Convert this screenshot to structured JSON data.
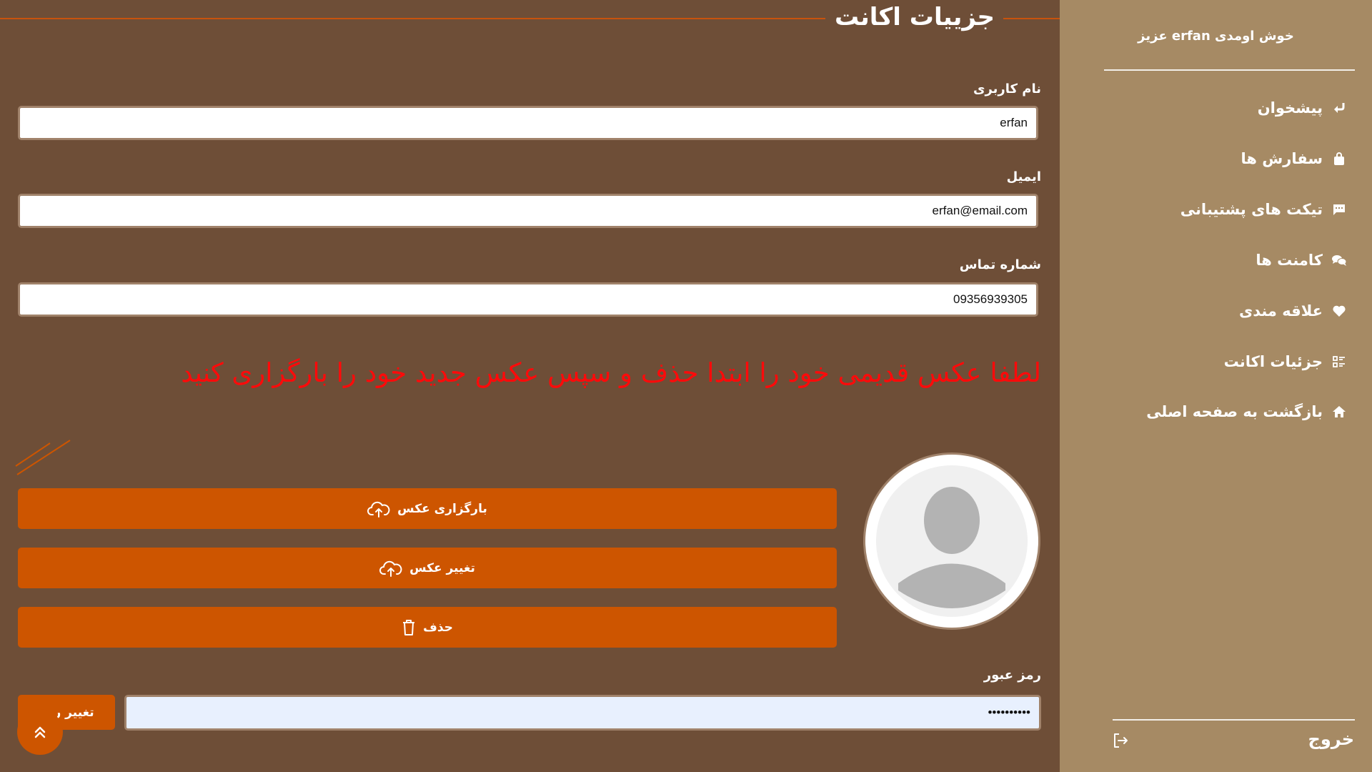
{
  "page": {
    "title": "جزییات اکانت"
  },
  "form": {
    "username": {
      "label": "نام کاربری",
      "value": "erfan"
    },
    "email": {
      "label": "ایمیل",
      "value": "erfan@email.com"
    },
    "phone": {
      "label": "شماره تماس",
      "value": "09356939305"
    },
    "warning": "لطفا عکس قدیمی خود را ابتدا حذف و سپس عکس جدید خود را بارگزاری کنید",
    "upload_button": "بارگزاری عکس",
    "change_button": "تغییر عکس",
    "delete_button": "حذف",
    "password": {
      "label": "رمز عبور",
      "value": "••••••••••"
    },
    "change_password_button": "تغییر رمز"
  },
  "sidebar": {
    "welcome": "خوش اومدی erfan عزیز",
    "items": [
      {
        "label": "پیشخوان",
        "icon": "return-arrow-icon"
      },
      {
        "label": "سفارش ها",
        "icon": "shopping-bag-icon"
      },
      {
        "label": "تیکت های پشتیبانی",
        "icon": "message-icon"
      },
      {
        "label": "کامنت ها",
        "icon": "comments-icon"
      },
      {
        "label": "علاقه مندی",
        "icon": "heart-icon"
      },
      {
        "label": "جزئیات اکانت",
        "icon": "list-details-icon"
      },
      {
        "label": "بازگشت به صفحه اصلی",
        "icon": "home-icon"
      }
    ],
    "logout": "خروج"
  },
  "colors": {
    "main_bg": "#6e4e37",
    "sidebar_bg": "#a68a64",
    "accent": "#cd5500",
    "warning": "#ff0a0a"
  }
}
